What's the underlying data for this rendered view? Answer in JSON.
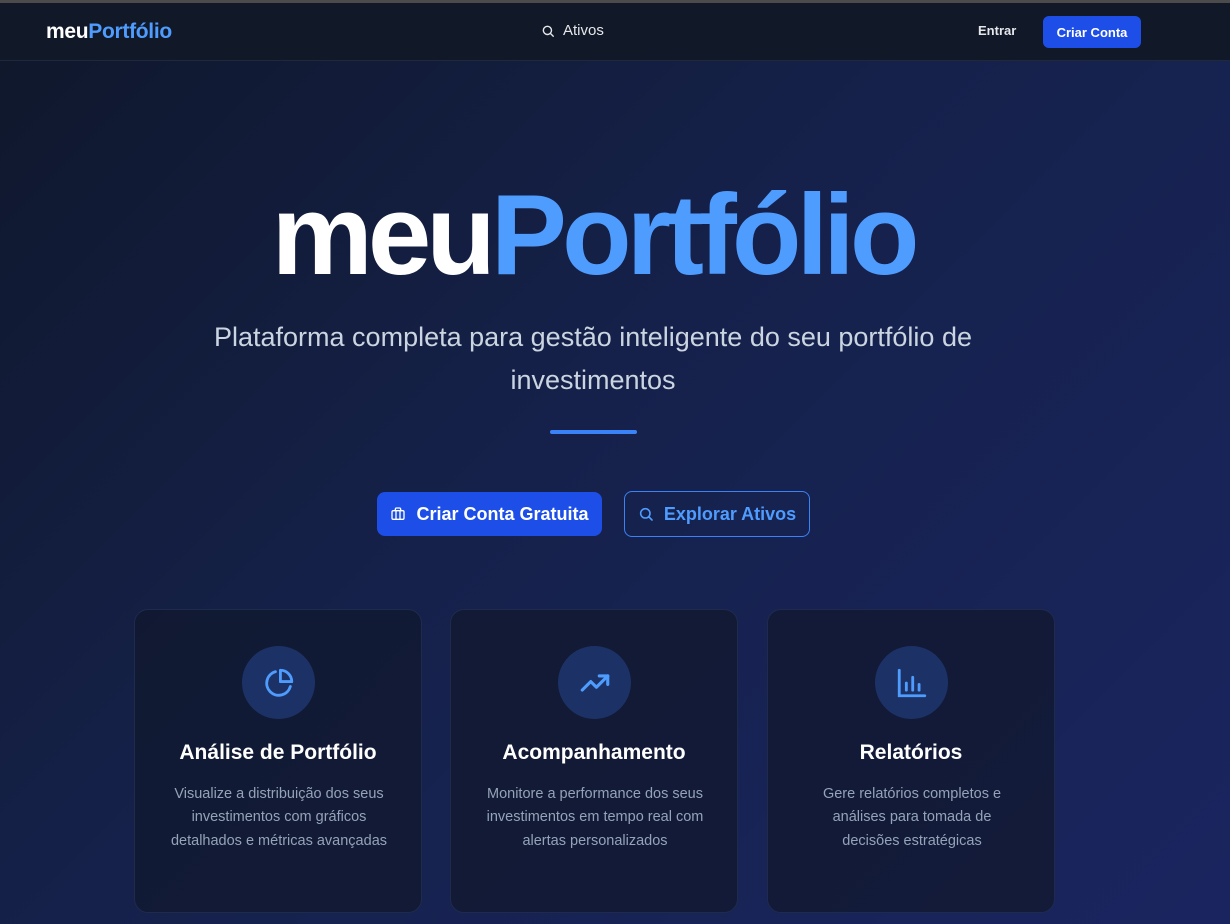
{
  "navbar": {
    "brand_part1": "meu",
    "brand_part2": "Portfólio",
    "search_label": "Ativos",
    "login_label": "Entrar",
    "signup_label": "Criar Conta"
  },
  "hero": {
    "title_part1": "meu",
    "title_part2": "Portfólio",
    "subtitle": "Plataforma completa para gestão inteligente do seu portfólio de investimentos",
    "primary_cta": "Criar Conta Gratuita",
    "secondary_cta": "Explorar Ativos"
  },
  "features": [
    {
      "icon": "pie-chart-icon",
      "title": "Análise de Portfólio",
      "description": "Visualize a distribuição dos seus investimentos com gráficos detalhados e métricas avançadas"
    },
    {
      "icon": "trending-up-icon",
      "title": "Acompanhamento",
      "description": "Monitore a performance dos seus investimentos em tempo real com alertas personalizados"
    },
    {
      "icon": "bar-chart-icon",
      "title": "Relatórios",
      "description": "Gere relatórios completos e análises para tomada de decisões estratégicas"
    }
  ],
  "colors": {
    "accent": "#4f9cff",
    "primary_button": "#1d4fe8",
    "navbar_bg": "#111827",
    "background": "#15214a"
  }
}
